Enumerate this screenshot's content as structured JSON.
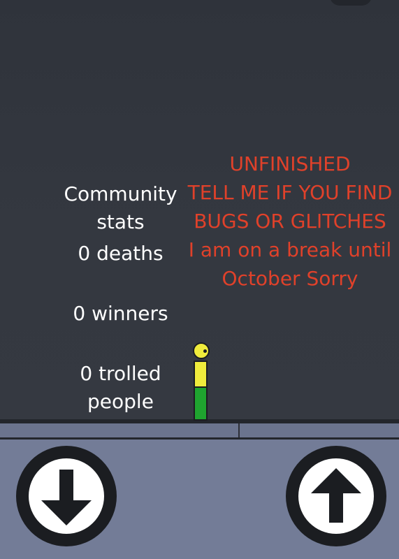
{
  "stats": {
    "heading": [
      "Community",
      "stats"
    ],
    "deaths": "0 deaths",
    "winners": "0 winners",
    "trolled": [
      "0 trolled",
      "people"
    ]
  },
  "notice": {
    "lines": [
      "UNFINISHED",
      "TELL ME IF YOU FIND",
      "BUGS OR GLITCHES",
      "I am on a break until",
      "October Sorry"
    ]
  },
  "controls": {
    "down_icon": "arrow-down-icon",
    "up_icon": "arrow-up-icon"
  },
  "colors": {
    "background": "#33373f",
    "notice_text": "#e0412a",
    "ground": "#737c97",
    "player_yellow": "#f0ec3c",
    "player_green": "#1fa42f"
  }
}
